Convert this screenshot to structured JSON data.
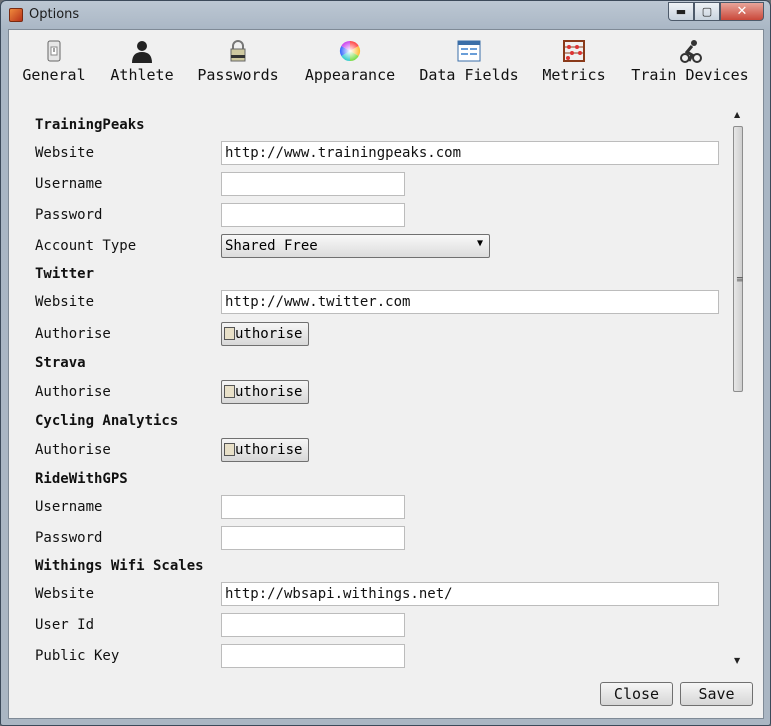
{
  "window": {
    "title": "Options",
    "minimize": "▬",
    "maximize": "▢",
    "close": "✕"
  },
  "tabs": [
    {
      "label": "General",
      "icon": "general-icon"
    },
    {
      "label": "Athlete",
      "icon": "athlete-icon"
    },
    {
      "label": "Passwords",
      "icon": "passwords-icon"
    },
    {
      "label": "Appearance",
      "icon": "appearance-icon"
    },
    {
      "label": "Data Fields",
      "icon": "data-fields-icon"
    },
    {
      "label": "Metrics",
      "icon": "metrics-icon"
    },
    {
      "label": "Train Devices",
      "icon": "train-devices-icon"
    }
  ],
  "trainingpeaks": {
    "heading": "TrainingPeaks",
    "website_label": "Website",
    "website_value": "http://www.trainingpeaks.com",
    "username_label": "Username",
    "username_value": "",
    "password_label": "Password",
    "password_value": "",
    "account_type_label": "Account Type",
    "account_type_value": "Shared Free"
  },
  "twitter": {
    "heading": "Twitter",
    "website_label": "Website",
    "website_value": "http://www.twitter.com",
    "authorise_label": "Authorise",
    "authorise_button": "uthorise"
  },
  "strava": {
    "heading": "Strava",
    "authorise_label": "Authorise",
    "authorise_button": "uthorise"
  },
  "cycling_analytics": {
    "heading": "Cycling Analytics",
    "authorise_label": "Authorise",
    "authorise_button": "uthorise"
  },
  "ridewithgps": {
    "heading": "RideWithGPS",
    "username_label": "Username",
    "username_value": "",
    "password_label": "Password",
    "password_value": ""
  },
  "withings": {
    "heading": "Withings Wifi Scales",
    "website_label": "Website",
    "website_value": "http://wbsapi.withings.net/",
    "userid_label": "User Id",
    "userid_value": "",
    "publickey_label": "Public Key",
    "publickey_value": ""
  },
  "footer": {
    "close_label": "Close",
    "save_label": "Save"
  },
  "scrollbar": {
    "up_arrow": "▲",
    "down_arrow": "▼",
    "grip": "≡"
  },
  "colors": {
    "title_bar": "#bcc7d3",
    "window_bg": "#f0f0f0",
    "close_button": "#c9483a"
  }
}
